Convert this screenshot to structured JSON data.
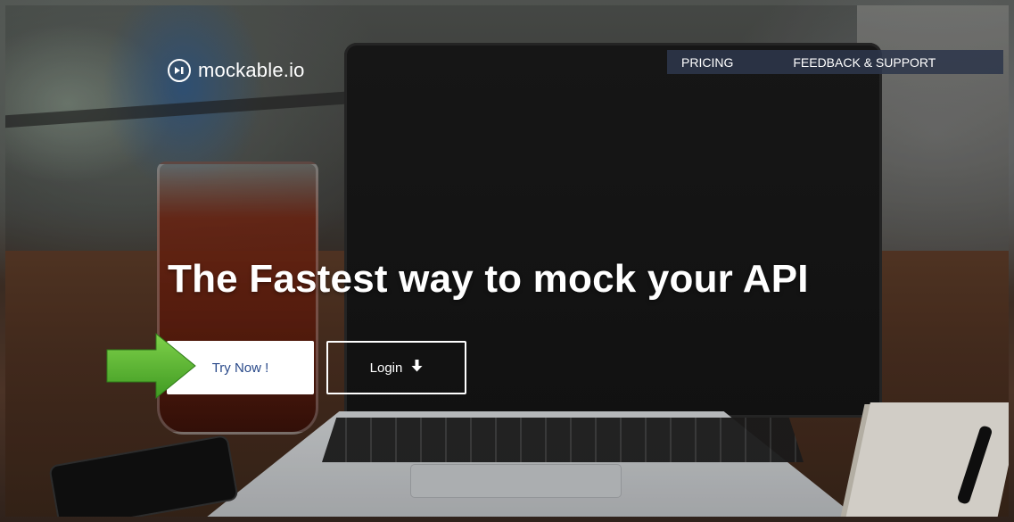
{
  "brand": {
    "name": "mockable.io",
    "icon": "play-circle-icon"
  },
  "nav": {
    "pricing": "PRICING",
    "feedback": "FEEDBACK & SUPPORT"
  },
  "hero": {
    "headline": "The Fastest way to mock your API",
    "try_label": "Try Now !",
    "login_label": "Login",
    "login_icon": "arrow-down-icon"
  },
  "colors": {
    "nav_bg": "#2d374b",
    "try_text": "#2a4a8a",
    "annotation_arrow": "#5cb531"
  }
}
